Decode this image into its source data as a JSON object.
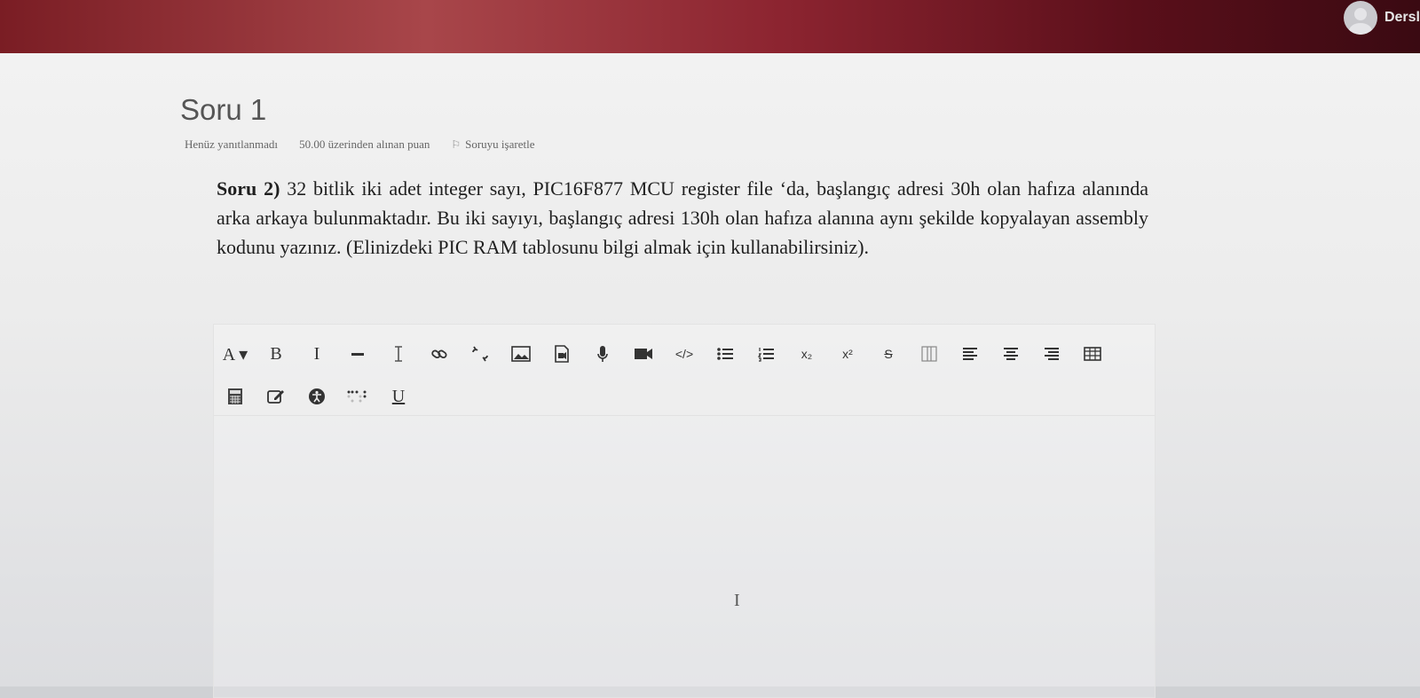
{
  "header": {
    "username": "Dersl",
    "avatar_icon": "user-avatar-icon"
  },
  "question": {
    "title": "Soru 1",
    "status": "Henüz yanıtlanmadı",
    "points": "50.00 üzerinden alınan puan",
    "flag_label": "Soruyu işaretle",
    "text_bold": "Soru 2)",
    "text_body": " 32 bitlik iki adet integer sayı, PIC16F877 MCU register file ‘da, başlangıç adresi 30h olan hafıza alanında arka arkaya bulunmaktadır. Bu iki sayıyı, başlangıç adresi 130h olan hafıza alanına aynı şekilde kopyalayan assembly kodunu yazınız. (Elinizdeki PIC RAM tablosunu bilgi almak için kullanabilirsiniz)."
  },
  "editor": {
    "toolbar_row1": [
      {
        "name": "font-button",
        "label": "A ▾"
      },
      {
        "name": "bold-button",
        "label": "B"
      },
      {
        "name": "italic-button",
        "label": "I"
      },
      {
        "name": "horizontal-rule-button",
        "icon": "hr-icon"
      },
      {
        "name": "text-cursor-button",
        "icon": "text-cursor-icon"
      },
      {
        "name": "link-button",
        "icon": "link-icon"
      },
      {
        "name": "unlink-button",
        "icon": "unlink-icon"
      },
      {
        "name": "image-button",
        "icon": "image-icon"
      },
      {
        "name": "media-button",
        "icon": "media-icon"
      },
      {
        "name": "record-audio-button",
        "icon": "microphone-icon"
      },
      {
        "name": "record-video-button",
        "icon": "video-camera-icon"
      },
      {
        "name": "html-button",
        "label": "</>"
      },
      {
        "name": "unordered-list-button",
        "icon": "bullet-list-icon"
      },
      {
        "name": "ordered-list-button",
        "icon": "numbered-list-icon"
      },
      {
        "name": "subscript-button",
        "label": "x₂"
      },
      {
        "name": "superscript-button",
        "label": "x²"
      },
      {
        "name": "strikethrough-button",
        "label": "S"
      },
      {
        "name": "column-button",
        "icon": "columns-icon"
      },
      {
        "name": "align-left-button",
        "icon": "align-left-icon"
      },
      {
        "name": "align-center-button",
        "icon": "align-center-icon"
      },
      {
        "name": "align-right-button",
        "icon": "align-right-icon"
      },
      {
        "name": "table-button",
        "icon": "table-icon"
      }
    ],
    "toolbar_row2": [
      {
        "name": "equation-button",
        "icon": "calculator-icon"
      },
      {
        "name": "manage-files-button",
        "icon": "edit-icon"
      },
      {
        "name": "accessibility-checker-button",
        "icon": "accessibility-icon"
      },
      {
        "name": "screenreader-helper-button",
        "icon": "braille-icon"
      },
      {
        "name": "underline-button",
        "label": "U"
      }
    ],
    "cursor_glyph": "I"
  },
  "colors": {
    "topbar": "#8c2430",
    "text": "#1f1f1f"
  }
}
